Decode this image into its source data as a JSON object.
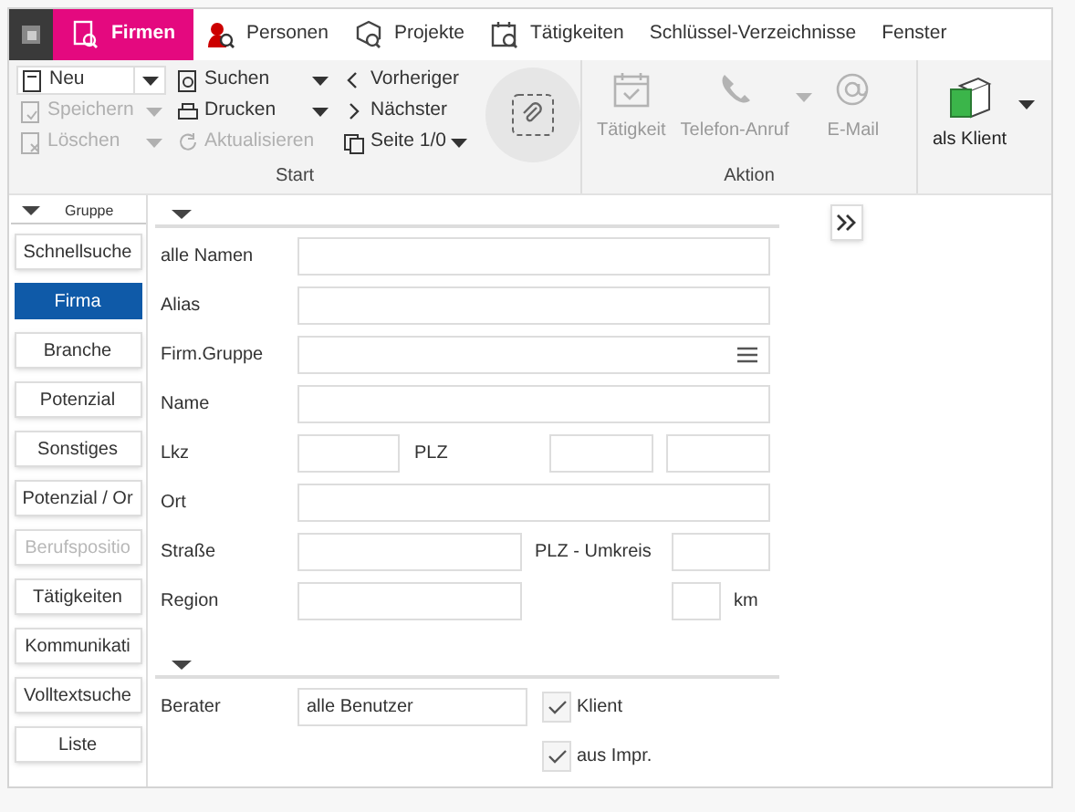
{
  "menu": [
    {
      "label": "Firmen",
      "selected": true
    },
    {
      "label": "Personen",
      "selected": false
    },
    {
      "label": "Projekte",
      "selected": false
    },
    {
      "label": "Tätigkeiten",
      "selected": false
    },
    {
      "label": "Schlüssel-Verzeichnisse",
      "selected": false
    },
    {
      "label": "Fenster",
      "selected": false
    }
  ],
  "ribbon": {
    "start": {
      "title": "Start",
      "columns": [
        [
          {
            "label": "Neu",
            "disabled": false,
            "kind": "split"
          },
          {
            "label": "Speichern",
            "disabled": true,
            "kind": "dropdown"
          },
          {
            "label": "Löschen",
            "disabled": true,
            "kind": "dropdown"
          }
        ],
        [
          {
            "label": "Suchen",
            "disabled": false,
            "kind": "dropdown"
          },
          {
            "label": "Drucken",
            "disabled": false,
            "kind": "dropdown"
          },
          {
            "label": "Aktualisieren",
            "disabled": true,
            "kind": "plain"
          }
        ],
        [
          {
            "label": "Vorheriger",
            "disabled": false,
            "kind": "plain"
          },
          {
            "label": "Nächster",
            "disabled": false,
            "kind": "plain"
          },
          {
            "label": "Seite 1/0",
            "disabled": false,
            "kind": "dropdown"
          }
        ]
      ]
    },
    "aktion": {
      "title": "Aktion",
      "items": [
        {
          "label": "Tätigkeit",
          "disabled": true,
          "dropdown": false
        },
        {
          "label": "Telefon-Anruf",
          "disabled": true,
          "dropdown": true
        },
        {
          "label": "E-Mail",
          "disabled": true,
          "dropdown": false
        }
      ]
    },
    "client": {
      "label": "als Klient",
      "disabled": false,
      "dropdown": true
    }
  },
  "sidebar": {
    "header": "Gruppe",
    "items": [
      {
        "label": "Schnellsuche",
        "selected": false,
        "disabled": false
      },
      {
        "label": "Firma",
        "selected": true,
        "disabled": false
      },
      {
        "label": "Branche",
        "selected": false,
        "disabled": false
      },
      {
        "label": "Potenzial",
        "selected": false,
        "disabled": false
      },
      {
        "label": "Sonstiges",
        "selected": false,
        "disabled": false
      },
      {
        "label": "Potenzial / Or",
        "selected": false,
        "disabled": false
      },
      {
        "label": "Berufspositio",
        "selected": false,
        "disabled": true
      },
      {
        "label": "Tätigkeiten",
        "selected": false,
        "disabled": false
      },
      {
        "label": "Kommunikati",
        "selected": false,
        "disabled": false
      },
      {
        "label": "Volltextsuche",
        "selected": false,
        "disabled": false
      },
      {
        "label": "Liste",
        "selected": false,
        "disabled": false
      }
    ]
  },
  "form": {
    "rows": [
      {
        "label": "alle Namen",
        "items": [
          {
            "kind": "field"
          }
        ]
      },
      {
        "label": "Alias",
        "items": [
          {
            "kind": "field"
          }
        ]
      },
      {
        "label": "Firm.Gruppe",
        "items": [
          {
            "kind": "list_field"
          }
        ]
      },
      {
        "label": "Name",
        "items": [
          {
            "kind": "field"
          }
        ]
      },
      {
        "label": "Lkz",
        "items": [
          {
            "kind": "field"
          },
          {
            "kind": "label",
            "text": "PLZ"
          },
          {
            "kind": "field"
          },
          {
            "kind": "field"
          }
        ]
      },
      {
        "label": "Ort",
        "items": [
          {
            "kind": "field"
          }
        ]
      },
      {
        "label": "Straße",
        "items": [
          {
            "kind": "field"
          },
          {
            "kind": "label",
            "text": "PLZ - Umkreis"
          },
          {
            "kind": "field"
          }
        ]
      },
      {
        "label": "Region",
        "items": [
          {
            "kind": "field"
          },
          {
            "kind": "field"
          },
          {
            "kind": "label",
            "text": "km"
          }
        ]
      }
    ],
    "berater": {
      "label": "Berater",
      "value": "alle Benutzer"
    },
    "checkboxes": [
      {
        "label": "Klient",
        "checked": true
      },
      {
        "label": "aus Impr.",
        "checked": true
      }
    ]
  }
}
